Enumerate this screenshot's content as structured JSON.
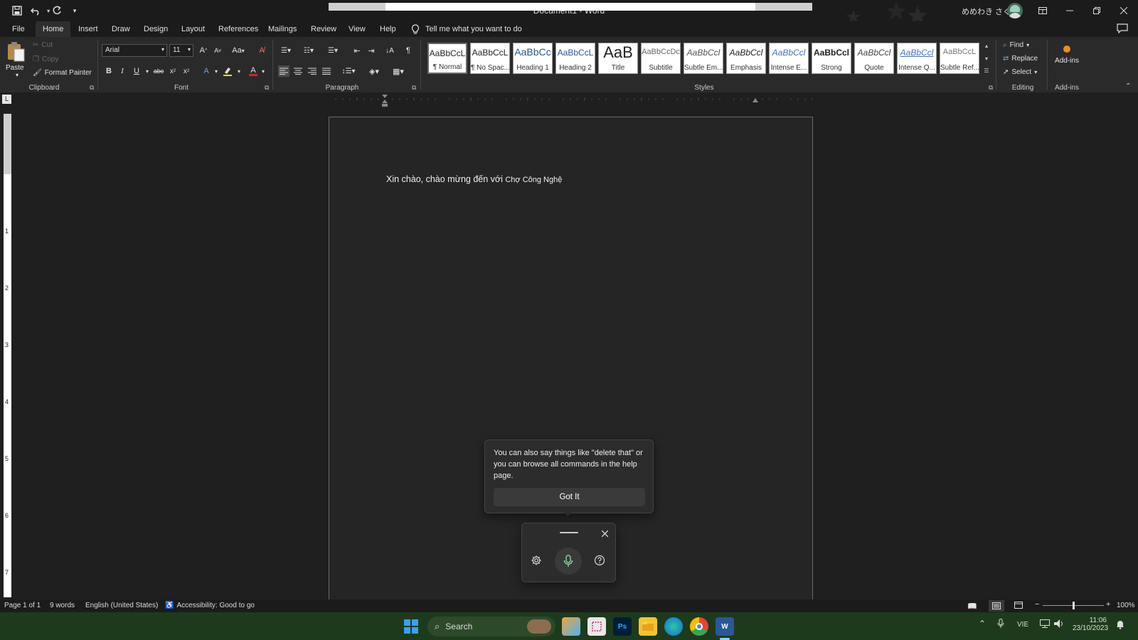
{
  "title_bar": {
    "doc_title": "Document1  -  Word",
    "user_name": "めめわき さくら",
    "quick_access": [
      "save-icon",
      "undo-icon",
      "redo-icon",
      "customize-icon"
    ]
  },
  "menu": {
    "tabs": [
      "File",
      "Home",
      "Insert",
      "Draw",
      "Design",
      "Layout",
      "References",
      "Mailings",
      "Review",
      "View",
      "Help"
    ],
    "active": "Home",
    "tell_me": "Tell me what you want to do"
  },
  "ribbon": {
    "clipboard": {
      "paste": "Paste",
      "cut": "Cut",
      "copy": "Copy",
      "format_painter": "Format Painter",
      "label": "Clipboard"
    },
    "font": {
      "name": "Arial",
      "size": "11",
      "label": "Font",
      "case_btn": "Aa"
    },
    "paragraph": {
      "label": "Paragraph"
    },
    "styles": {
      "label": "Styles",
      "items": [
        {
          "sample": "AaBbCcL",
          "name": "¶ Normal"
        },
        {
          "sample": "AaBbCcL",
          "name": "¶ No Spac..."
        },
        {
          "sample": "AaBbCc",
          "name": "Heading 1"
        },
        {
          "sample": "AaBbCcL",
          "name": "Heading 2"
        },
        {
          "sample": "AaB",
          "name": "Title"
        },
        {
          "sample": "AaBbCcDc",
          "name": "Subtitle"
        },
        {
          "sample": "AaBbCcl",
          "name": "Subtle Em..."
        },
        {
          "sample": "AaBbCcl",
          "name": "Emphasis"
        },
        {
          "sample": "AaBbCcl",
          "name": "Intense E..."
        },
        {
          "sample": "AaBbCcl",
          "name": "Strong"
        },
        {
          "sample": "AaBbCcl",
          "name": "Quote"
        },
        {
          "sample": "AaBbCcl",
          "name": "Intense Q..."
        },
        {
          "sample": "AaBbCcL",
          "name": "Subtle Ref..."
        }
      ]
    },
    "editing": {
      "find": "Find",
      "replace": "Replace",
      "select": "Select",
      "label": "Editing"
    },
    "addins": {
      "button": "Add-ins",
      "label": "Add-ins"
    }
  },
  "ruler": {
    "h_numbers": [
      "1",
      "1",
      "2",
      "3",
      "4",
      "5",
      "6",
      "7"
    ],
    "v_numbers": [
      "1",
      "2",
      "3",
      "4",
      "5",
      "6",
      "7"
    ]
  },
  "document": {
    "text_main": "Xin chào, chào mừng đến với ",
    "text_brand": "Chợ Công Nghệ"
  },
  "voice_tip": {
    "text": "You can also say things like \"delete that\" or you can browse all commands in the help page.",
    "button": "Got It"
  },
  "status": {
    "page": "Page 1 of 1",
    "words": "9 words",
    "language": "English (United States)",
    "accessibility": "Accessibility: Good to go",
    "zoom": "100%",
    "zoom_level": 100
  },
  "taskbar": {
    "search": "Search",
    "ps_label": "Ps",
    "word_label": "W",
    "lang": "VIE",
    "time": "11:06",
    "date": "23/10/2023"
  }
}
